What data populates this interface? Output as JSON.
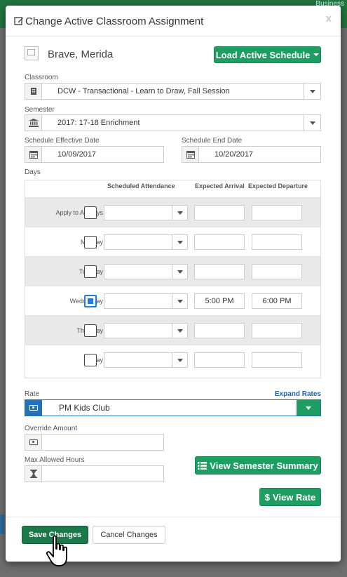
{
  "backdrop": {
    "brand_fragment": "Business"
  },
  "modal": {
    "title": "Change Active Classroom Assignment",
    "close_label": "x",
    "child_name": "Brave, Merida",
    "load_schedule_label": "Load Active Schedule"
  },
  "classroom": {
    "label": "Classroom",
    "value": "DCW - Transactional - Learn to Draw, Fall Session"
  },
  "semester": {
    "label": "Semester",
    "value": "2017: 17-18 Enrichment"
  },
  "dates": {
    "effective_label": "Schedule Effective Date",
    "effective_value": "10/09/2017",
    "end_label": "Schedule End Date",
    "end_value": "10/20/2017"
  },
  "days": {
    "label": "Days",
    "col_attendance": "Scheduled Attendance",
    "col_arrival": "Expected Arrival",
    "col_departure": "Expected Departure",
    "rows": [
      {
        "label": "Apply to All Days",
        "checked": false,
        "arrival": "",
        "departure": ""
      },
      {
        "label": "Monday",
        "checked": false,
        "arrival": "",
        "departure": ""
      },
      {
        "label": "Tuesday",
        "checked": false,
        "arrival": "",
        "departure": ""
      },
      {
        "label": "Wednesday",
        "checked": true,
        "arrival": "5:00 PM",
        "departure": "6:00 PM"
      },
      {
        "label": "Thursday",
        "checked": false,
        "arrival": "",
        "departure": ""
      },
      {
        "label": "Friday",
        "checked": false,
        "arrival": "",
        "departure": ""
      }
    ]
  },
  "rate": {
    "label": "Rate",
    "expand_label": "Expand Rates",
    "value": "PM Kids Club"
  },
  "override": {
    "label": "Override Amount",
    "value": ""
  },
  "max_hours": {
    "label": "Max Allowed Hours",
    "value": ""
  },
  "actions": {
    "semester_summary_label": "View Semester Summary",
    "view_rate_label": "View Rate",
    "save_label": "Save Changes",
    "cancel_label": "Cancel Changes"
  },
  "colors": {
    "primary_green": "#1f9e63",
    "save_green": "#1c7a4a",
    "link_blue": "#1565c0",
    "checkbox_blue": "#1c7ee0"
  }
}
